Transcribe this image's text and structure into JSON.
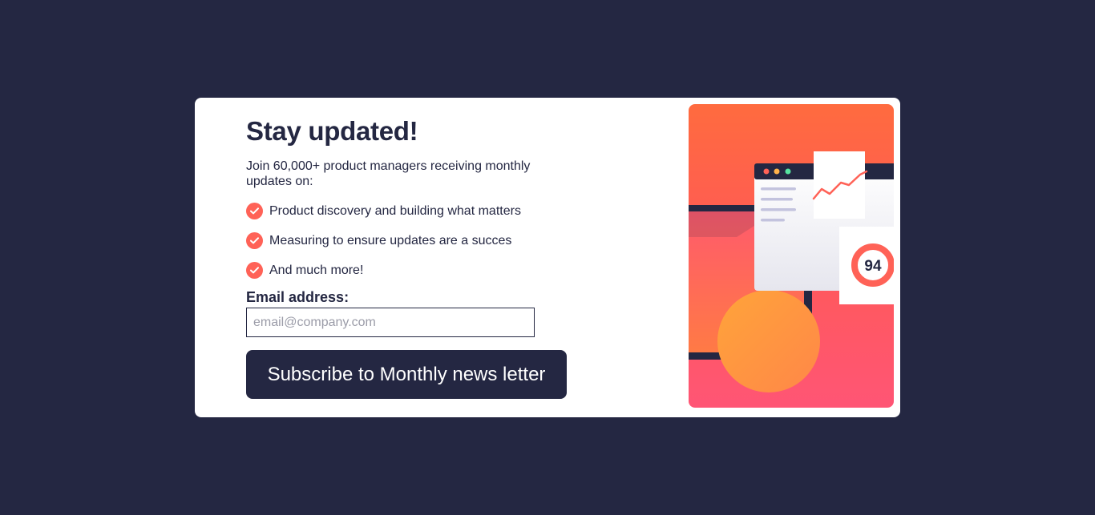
{
  "signup": {
    "title": "Stay updated!",
    "intro": "Join 60,000+ product managers receiving monthly updates on:",
    "benefits": [
      "Product discovery and building what matters",
      "Measuring to ensure updates are a succes",
      "And much more!"
    ],
    "email_label": "Email address:",
    "email_placeholder": "email@company.com",
    "email_value": "",
    "subscribe_label": "Subscribe to Monthly news letter"
  },
  "illustration": {
    "score": "94",
    "icons": [
      "check-icon",
      "browser-window-icon",
      "line-chart-icon",
      "score-gauge-icon"
    ]
  },
  "colors": {
    "page_background": "#242742",
    "card_background": "#ffffff",
    "text_dark": "#242742",
    "accent_tomato": "#ff6257",
    "illustration_top": "#ff6b3f",
    "illustration_bottom": "#ff5575"
  }
}
